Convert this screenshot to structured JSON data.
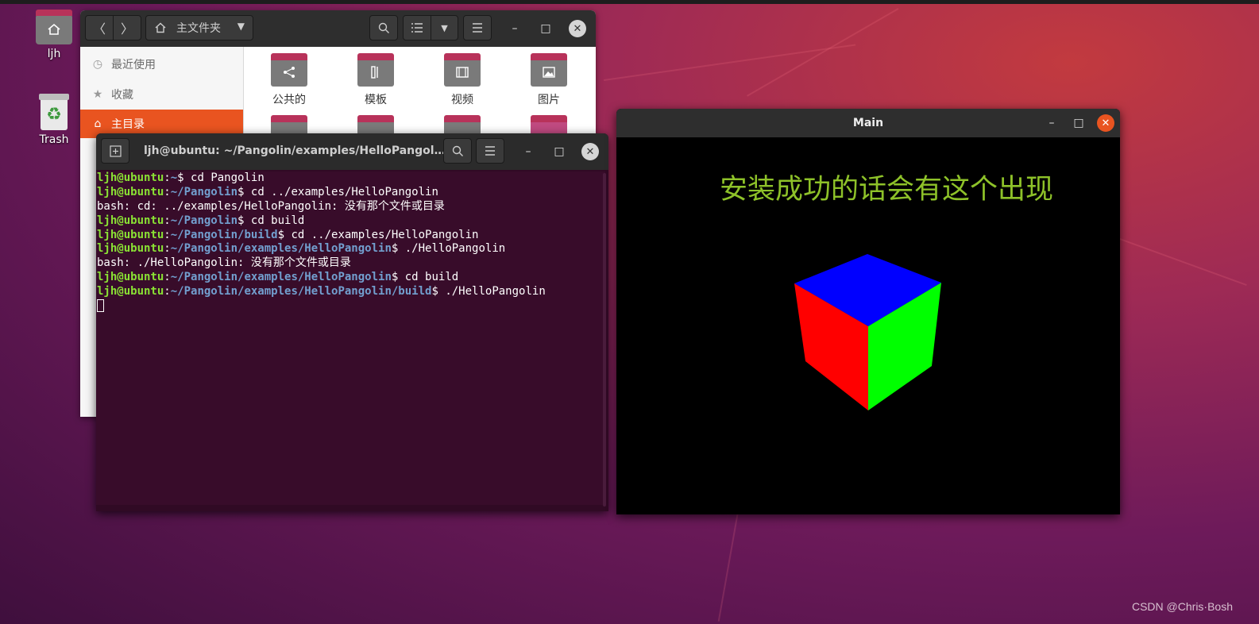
{
  "desktop": {
    "home_icon_label": "ljh",
    "trash_label": "Trash",
    "watermark": "CSDN @Chris·Bosh"
  },
  "file_manager": {
    "location": "主文件夹",
    "sidebar": [
      {
        "label": "最近使用",
        "icon": "clock-icon"
      },
      {
        "label": "收藏",
        "icon": "star-icon"
      },
      {
        "label": "主目录",
        "icon": "home-icon"
      }
    ],
    "folders": [
      {
        "label": "公共的",
        "icon": "share-icon"
      },
      {
        "label": "模板",
        "icon": "template-icon"
      },
      {
        "label": "视频",
        "icon": "video-icon"
      },
      {
        "label": "图片",
        "icon": "picture-icon"
      }
    ]
  },
  "terminal": {
    "title": "ljh@ubuntu: ~/Pangolin/examples/HelloPangolin..."
  },
  "pangolin": {
    "title": "Main",
    "text": "安装成功的话会有这个出现"
  },
  "colors": {
    "accent": "#e95420",
    "prompt_user": "#8ae234",
    "prompt_path": "#729fcf",
    "terminal_bg": "#380c2a",
    "cube_top": "#0000ff",
    "cube_left": "#ff0000",
    "cube_right": "#00ff00",
    "pangolin_text": "#8ec229"
  }
}
